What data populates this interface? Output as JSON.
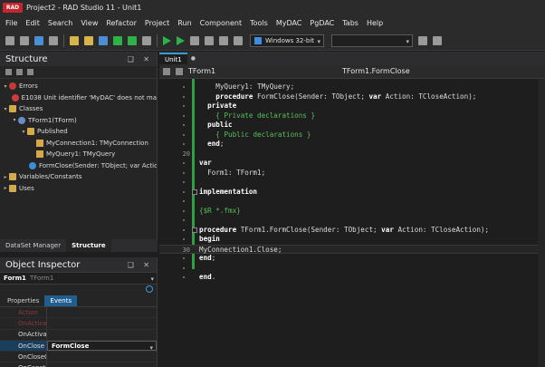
{
  "window": {
    "logo_text": "RAD",
    "title": "Project2 - RAD Studio 11 - Unit1"
  },
  "menu": [
    "File",
    "Edit",
    "Search",
    "View",
    "Refactor",
    "Project",
    "Run",
    "Component",
    "Tools",
    "MyDAC",
    "PgDAC",
    "Tabs",
    "Help"
  ],
  "toolbar": {
    "platform": "Windows 32-bit",
    "config": ""
  },
  "structure": {
    "title": "Structure",
    "actions": "❑ ✕",
    "tree": [
      {
        "indent": 0,
        "expander": "▾",
        "icon": "errors-node",
        "label": "Errors"
      },
      {
        "indent": 1,
        "expander": "",
        "icon": "error",
        "label": "E1038 Unit identifier 'MyDAC' does not ma"
      },
      {
        "indent": 0,
        "expander": "▾",
        "icon": "folder",
        "label": "Classes"
      },
      {
        "indent": 1,
        "expander": "▾",
        "icon": "class",
        "label": "TForm1(TForm)"
      },
      {
        "indent": 2,
        "expander": "▾",
        "icon": "folder",
        "label": "Published"
      },
      {
        "indent": 3,
        "expander": "",
        "icon": "field",
        "label": "MyConnection1: TMyConnection"
      },
      {
        "indent": 3,
        "expander": "",
        "icon": "field",
        "label": "MyQuery1: TMyQuery"
      },
      {
        "indent": 3,
        "expander": "",
        "icon": "method",
        "label": "FormClose(Sender: TObject; var Actio"
      },
      {
        "indent": 0,
        "expander": "▸",
        "icon": "folder",
        "label": "Variables/Constants"
      },
      {
        "indent": 0,
        "expander": "▸",
        "icon": "folder",
        "label": "Uses"
      }
    ],
    "tabs": [
      "DataSet Manager",
      "Structure"
    ]
  },
  "object_inspector": {
    "title": "Object Inspector",
    "actions": "❑ ✕",
    "object_name": "Form1",
    "object_type": "TForm1",
    "tabs": [
      "Properties",
      "Events"
    ],
    "rows": [
      {
        "name": "Action",
        "value": "",
        "faded": true
      },
      {
        "name": "OnActivate",
        "value": "",
        "faded": true
      },
      {
        "name": "OnActivate",
        "value": "",
        "faded": false
      },
      {
        "name": "OnClose",
        "value": "FormClose",
        "faded": false,
        "selected": true
      },
      {
        "name": "OnCloseQuery",
        "value": "",
        "faded": false
      },
      {
        "name": "OnConstrained",
        "value": "",
        "faded": false
      }
    ]
  },
  "editor": {
    "tab": "Unit1",
    "tab_add": "●",
    "nav_class": "TForm1",
    "nav_method": "TForm1.FormClose",
    "lines": [
      {
        "no": "",
        "html": "    MyQuery1: TMyQuery;"
      },
      {
        "no": "",
        "html": "    <span class='kw'>procedure</span> FormClose(Sender: TObject; <span class='kw'>var</span> Action: TCloseAction);"
      },
      {
        "no": "",
        "html": "  <span class='kw'>private</span>"
      },
      {
        "no": "",
        "html": "    <span class='cm'>{ Private declarations }</span>"
      },
      {
        "no": "",
        "html": "  <span class='kw'>public</span>"
      },
      {
        "no": "",
        "html": "    <span class='cm'>{ Public declarations }</span>"
      },
      {
        "no": "",
        "html": "  <span class='kw'>end</span>;"
      },
      {
        "no": "20",
        "html": ""
      },
      {
        "no": "",
        "html": "<span class='kw'>var</span>"
      },
      {
        "no": "",
        "html": "  Form1: TForm1;"
      },
      {
        "no": "",
        "html": ""
      },
      {
        "no": "",
        "html": "<span class='kw'>implementation</span>",
        "fold": true
      },
      {
        "no": "",
        "html": ""
      },
      {
        "no": "",
        "html": "<span class='cm'>{$R *.fmx}</span>"
      },
      {
        "no": "",
        "html": ""
      },
      {
        "no": "",
        "html": "<span class='kw'>procedure</span> TForm1.FormClose(Sender: TObject; <span class='kw'>var</span> Action: TCloseAction);",
        "fold": true
      },
      {
        "no": "",
        "html": "<span class='kw'>begin</span>"
      },
      {
        "no": "30",
        "html": "MyConnection1.Close;",
        "current": true
      },
      {
        "no": "",
        "html": "<span class='kw'>end</span>;"
      },
      {
        "no": "",
        "html": ""
      },
      {
        "no": "",
        "html": "<span class='kw'>end</span>."
      }
    ]
  }
}
